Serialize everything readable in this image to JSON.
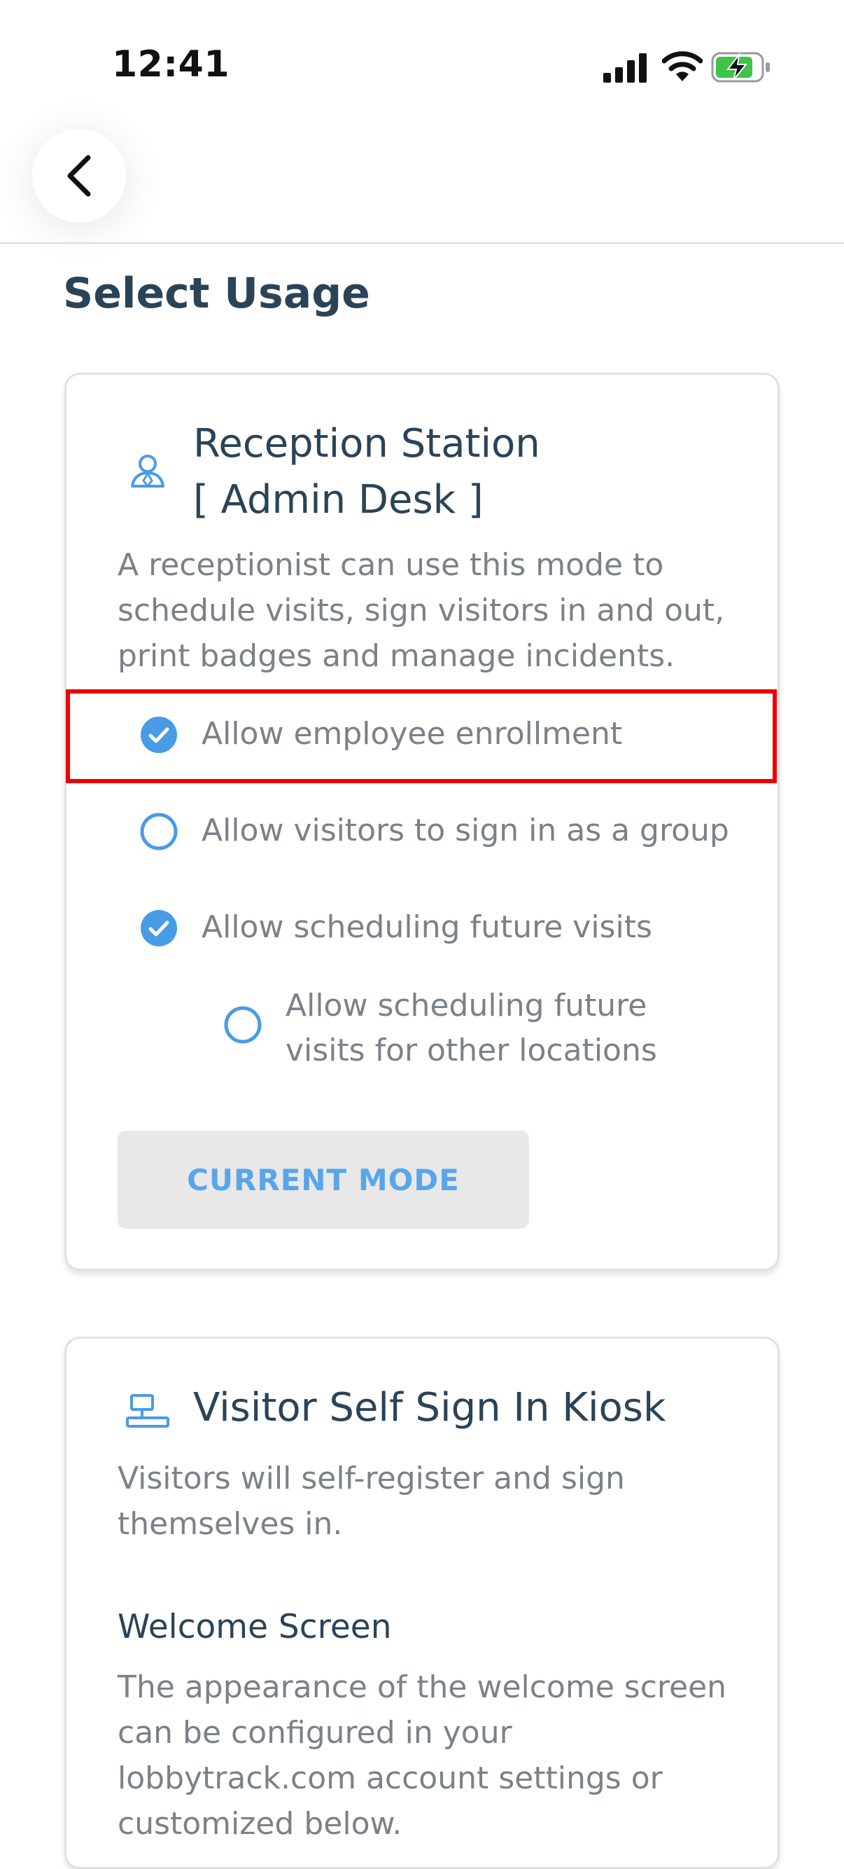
{
  "status_bar": {
    "time": "12:41"
  },
  "page": {
    "title": "Select Usage"
  },
  "reception": {
    "title_line1": "Reception Station",
    "title_line2": "[ Admin Desk ]",
    "description_lines": [
      "A receptionist can use this mode to",
      "schedule visits, sign visitors in and out,",
      "print badges and manage incidents."
    ],
    "options": [
      {
        "label": "Allow employee enrollment",
        "checked": true
      },
      {
        "label": "Allow visitors to sign in as a group",
        "checked": false
      },
      {
        "label": "Allow scheduling future visits",
        "checked": true
      }
    ],
    "sub_option": {
      "label_line1": "Allow scheduling future",
      "label_line2": "visits for other locations",
      "checked": false
    },
    "button_label": "CURRENT MODE"
  },
  "kiosk": {
    "title": "Visitor Self Sign In Kiosk",
    "description_lines": [
      "Visitors will self-register and sign",
      "themselves in."
    ],
    "welcome_heading": "Welcome Screen",
    "welcome_lines": [
      "The appearance of the welcome screen",
      "can be configured in your",
      "lobbytrack.com account settings or",
      "customized below."
    ]
  },
  "colors": {
    "accent": "#4a9be6",
    "title_text": "#2a4357",
    "body_text": "#7b8189",
    "highlight": "#ee0000",
    "button_bg": "#e8e8e8"
  },
  "icons": {
    "back": "chevron-left-icon",
    "reception": "receptionist-icon",
    "kiosk": "kiosk-icon",
    "checked": "check-circle-icon",
    "unchecked": "radio-empty-icon"
  }
}
